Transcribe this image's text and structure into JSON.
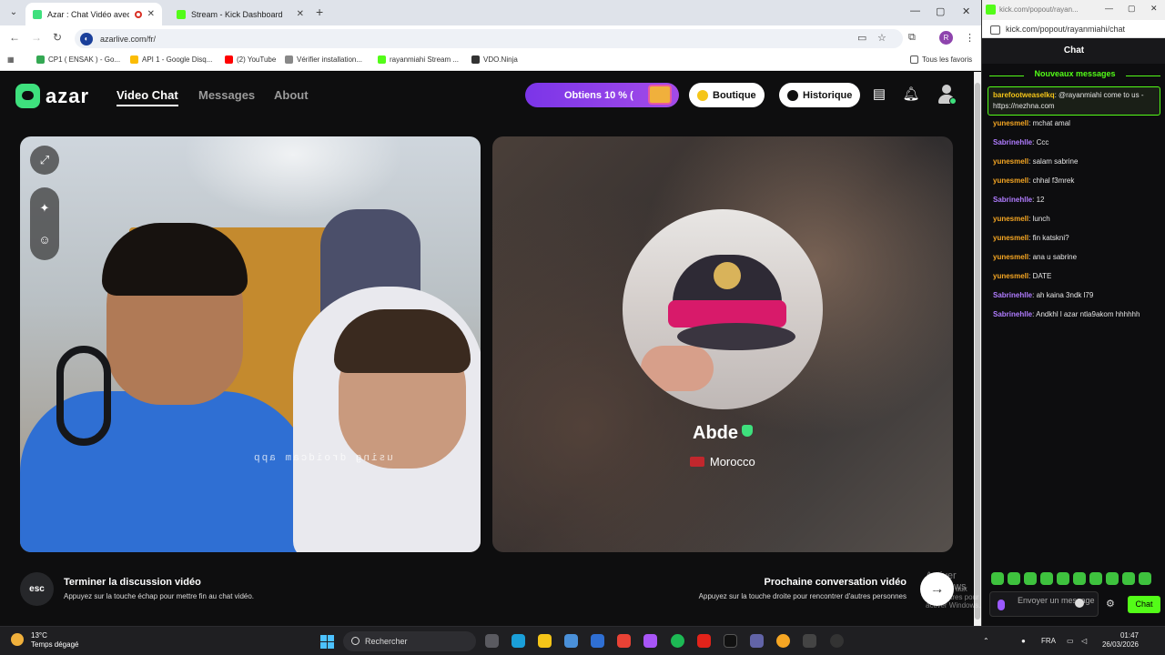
{
  "browser": {
    "tabs": [
      {
        "title": "Azar : Chat Vidéo avec de n",
        "active": true
      },
      {
        "title": "Stream - Kick Dashboard",
        "active": false
      }
    ],
    "url": "azarlive.com/fr/",
    "profile_initial": "R",
    "bookmarks": [
      "CP1 ( ENSAK ) - Go...",
      "API 1 - Google Disq...",
      "(2) YouTube",
      "Vérifier installation...",
      "rayanmiahi Stream ...",
      "VDO.Ninja"
    ],
    "bookmarks_folder": "Tous les favoris"
  },
  "azar": {
    "logo": "azar",
    "nav": [
      "Video Chat",
      "Messages",
      "About"
    ],
    "promo": "Obtiens 10 % (",
    "shop": "Boutique",
    "history": "Historique",
    "watermark": "using droidcam app",
    "remote": {
      "name": "Abde",
      "country": "Morocco"
    },
    "esc_key": "esc",
    "end_title": "Terminer la discussion vidéo",
    "end_hint": "Appuyez sur la touche échap pour mettre fin au chat vidéo.",
    "next_title": "Prochaine conversation vidéo",
    "next_hint": "Appuyez sur la touche droite pour rencontrer d'autres personnes",
    "next_icon": "→",
    "activate_title": "Activer Windows",
    "activate_sub": "Accédez aux paramètres pour activer Windows."
  },
  "kick": {
    "window_title": "kick.com/popout/rayan...",
    "url": "kick.com/popout/rayanmiahi/chat",
    "header": "Chat",
    "new_messages": "Nouveaux messages",
    "highlight": {
      "user": "barefootweaselkq",
      "text": ": @rayanmiahi come to us - https://nezhna.com"
    },
    "messages": [
      {
        "user": "yunesmell",
        "text": ": mchat amal",
        "color": "#f5a623"
      },
      {
        "user": "Sabrinehlle",
        "text": ": Ccc",
        "color": "#b07cff"
      },
      {
        "user": "yunesmell",
        "text": ": salam sabrine",
        "color": "#f5a623"
      },
      {
        "user": "yunesmell",
        "text": ": chhal f3mrek",
        "color": "#f5a623"
      },
      {
        "user": "Sabrinehlle",
        "text": ": 12",
        "color": "#b07cff"
      },
      {
        "user": "yunesmell",
        "text": ": lunch",
        "color": "#f5a623"
      },
      {
        "user": "yunesmell",
        "text": ": fin katskni?",
        "color": "#f5a623"
      },
      {
        "user": "yunesmell",
        "text": ": ana u sabrine",
        "color": "#f5a623"
      },
      {
        "user": "yunesmell",
        "text": ": DATE",
        "color": "#f5a623"
      },
      {
        "user": "Sabrinehlle",
        "text": ": ah kaina 3ndk l79",
        "color": "#b07cff"
      },
      {
        "user": "Sabrinehlle",
        "text": ": Andkhl l azar ntla9akom hhhhhh",
        "color": "#b07cff"
      }
    ],
    "input_placeholder": "Envoyer un message",
    "send": "Chat"
  },
  "taskbar": {
    "weather_temp": "13°C",
    "weather_desc": "Temps dégagé",
    "search": "Rechercher",
    "lang": "FRA",
    "time": "01:47",
    "date": "26/03/2026"
  },
  "colors": {
    "accent": "#3ee07d",
    "kick": "#53fc18",
    "promo": "#7b35e8"
  }
}
